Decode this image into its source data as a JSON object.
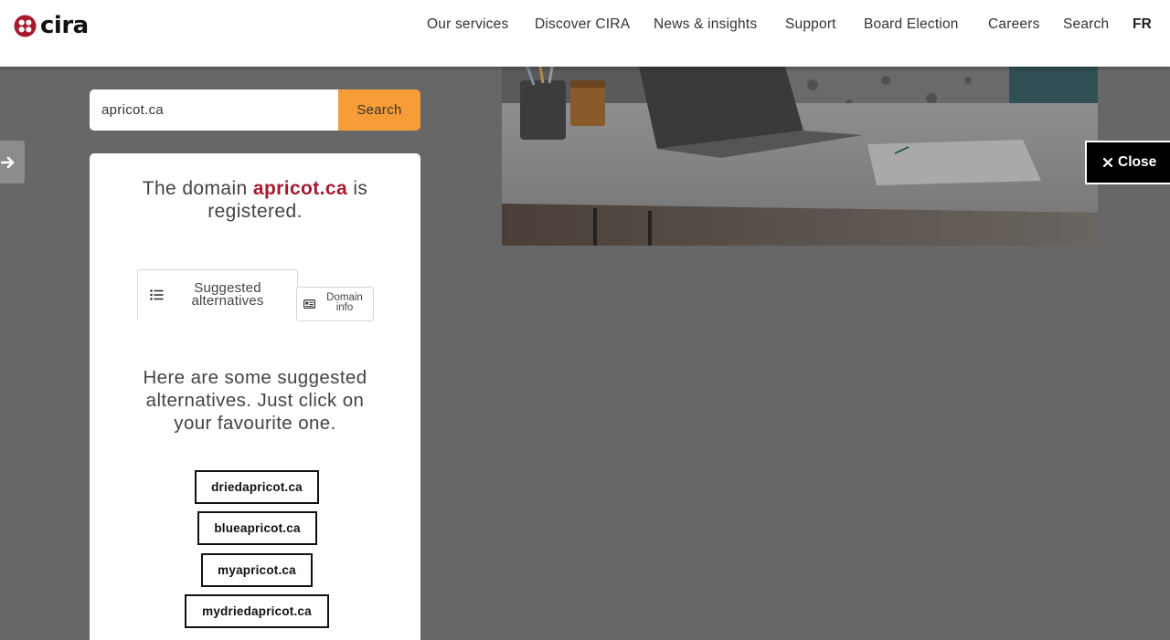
{
  "header": {
    "logo_text": "cira",
    "nav": {
      "our_services": "Our services",
      "discover_cira": "Discover CIRA",
      "news_insights": "News & insights",
      "support": "Support",
      "board_election": "Board Election",
      "careers": "Careers",
      "search": "Search",
      "language_toggle": "FR"
    }
  },
  "search": {
    "value": "apricot.ca",
    "button_label": "Search"
  },
  "result": {
    "status_prefix": "The domain ",
    "domain": "apricot.ca",
    "status_suffix": " is registered.",
    "tabs": {
      "alternatives": "Suggested alternatives",
      "domain_info": "Domain info"
    },
    "intro": "Here are some suggested alternatives. Just click on your favourite one.",
    "suggestions": [
      "driedapricot.ca",
      "blueapricot.ca",
      "myapricot.ca",
      "mydriedapricot.ca"
    ]
  },
  "close_label": "Close",
  "colors": {
    "brand_red": "#a6192e",
    "search_orange": "#f79d37",
    "overlay_gray": "#676767"
  },
  "icons": [
    "cira-logo-icon",
    "arrow-right-icon",
    "close-icon",
    "list-icon",
    "id-card-icon"
  ]
}
